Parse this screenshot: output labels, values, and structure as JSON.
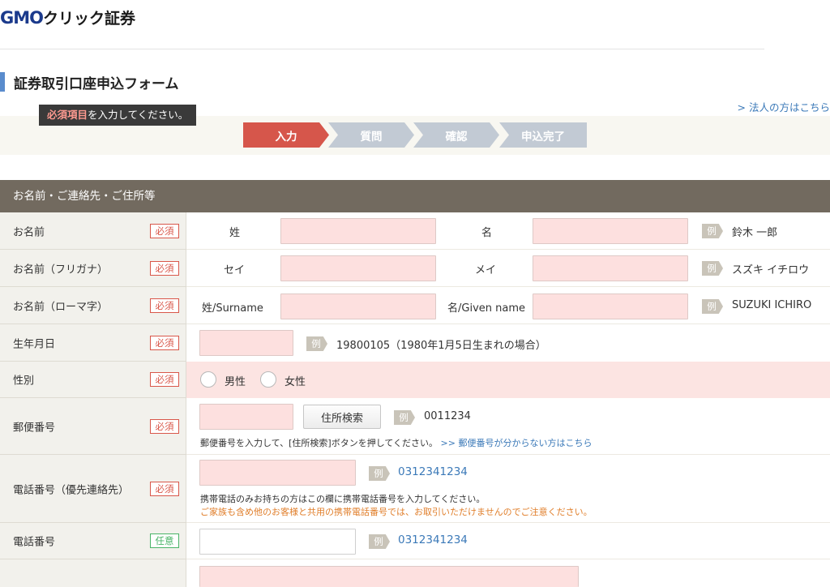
{
  "header": {
    "logo_latin": "GMO",
    "logo_kana": "クリック証券",
    "page_title": "証券取引口座申込フォーム",
    "corp_link": "> 法人の方はこちら"
  },
  "notice": {
    "required_highlight": "必須項目",
    "required_rest": "を入力してください。"
  },
  "steps": [
    {
      "label": "入力",
      "state": "active"
    },
    {
      "label": "質問",
      "state": "inactive"
    },
    {
      "label": "確認",
      "state": "inactive"
    },
    {
      "label": "申込完了",
      "state": "inactive"
    }
  ],
  "section": {
    "title": "お名前・ご連絡先・ご住所等"
  },
  "badges": {
    "required": "必須",
    "optional": "任意"
  },
  "example_tag": "例",
  "rows": {
    "name": {
      "label": "お名前",
      "sub1": "姓",
      "sub2": "名",
      "example": "鈴木 一郎"
    },
    "kana": {
      "label": "お名前（フリガナ）",
      "sub1": "セイ",
      "sub2": "メイ",
      "example": "スズキ イチロウ"
    },
    "roman": {
      "label": "お名前（ローマ字）",
      "sub1": "姓/Surname",
      "sub2": "名/Given name",
      "example": "SUZUKI ICHIRO"
    },
    "birth": {
      "label": "生年月日",
      "example": "19800105（1980年1月5日生まれの場合）"
    },
    "gender": {
      "label": "性別",
      "options": [
        "男性",
        "女性"
      ]
    },
    "postal": {
      "label": "郵便番号",
      "button": "住所検索",
      "example": "0011234",
      "note": "郵便番号を入力して、[住所検索]ボタンを押してください。",
      "note_link": ">> 郵便番号が分からない方はこちら"
    },
    "phone_primary": {
      "label": "電話番号（優先連絡先）",
      "example": "0312341234",
      "note1": "携帯電話のみお持ちの方はこの欄に携帯電話番号を入力してください。",
      "note2": "ご家族も含め他のお客様と共用の携帯電話番号では、お取引いただけませんのでご注意ください。"
    },
    "phone": {
      "label": "電話番号",
      "example": "0312341234"
    }
  },
  "colors": {
    "accent_blue": "#3b79b8",
    "step_active": "#d6564b",
    "step_inactive": "#c2cad4",
    "section_header": "#726a5f",
    "required_red": "#d9574a",
    "optional_green": "#4ab467",
    "input_pink": "#fde0df"
  }
}
